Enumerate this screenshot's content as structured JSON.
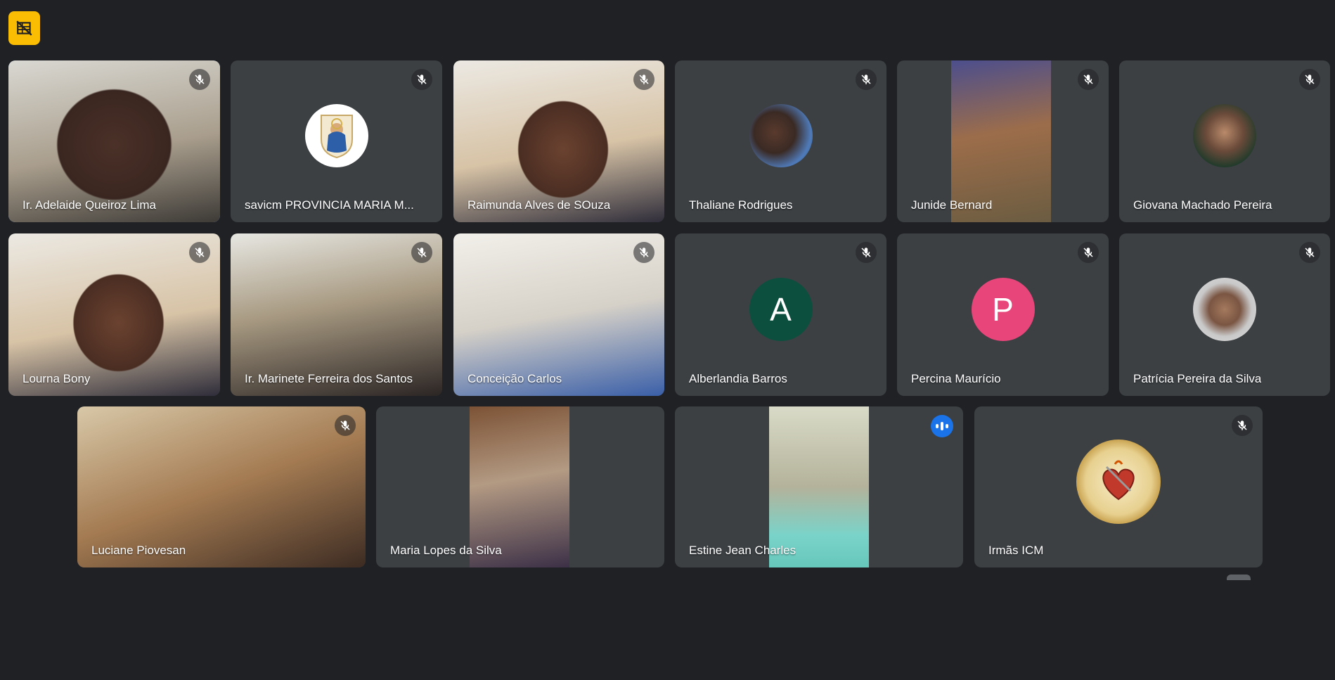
{
  "corner_button": {
    "icon": "no-video-layout-icon",
    "color": "#fbbc04"
  },
  "participants": [
    {
      "name": "Ir. Adelaide Queiroz Lima",
      "mic": "muted",
      "active": true
    },
    {
      "name": "savicm PROVINCIA MARIA M...",
      "mic": "muted",
      "avatar": "crest"
    },
    {
      "name": "Raimunda Alves de SOuza",
      "mic": "muted"
    },
    {
      "name": "Thaliane Rodrigues",
      "mic": "muted",
      "avatar": "photo"
    },
    {
      "name": "Junide Bernard",
      "mic": "muted"
    },
    {
      "name": "Giovana Machado Pereira",
      "mic": "muted",
      "avatar": "photo"
    },
    {
      "name": "Lourna Bony",
      "mic": "muted"
    },
    {
      "name": "Ir. Marinete Ferreira dos Santos",
      "mic": "muted"
    },
    {
      "name": "Conceição Carlos",
      "mic": "muted"
    },
    {
      "name": "Alberlandia Barros",
      "mic": "muted",
      "avatar_letter": "A",
      "avatar_color": "#0d4f3f"
    },
    {
      "name": "Percina Maurício",
      "mic": "muted",
      "avatar_letter": "P",
      "avatar_color": "#e8457a"
    },
    {
      "name": "Patrícia Pereira da Silva",
      "mic": "muted",
      "avatar": "photo"
    },
    {
      "name": "Luciane Piovesan",
      "mic": "muted"
    },
    {
      "name": "Maria Lopes da Silva",
      "mic": "none"
    },
    {
      "name": "Estine Jean Charles",
      "mic": "speaking"
    },
    {
      "name": "Irmãs ICM",
      "mic": "muted",
      "avatar": "seal"
    }
  ]
}
